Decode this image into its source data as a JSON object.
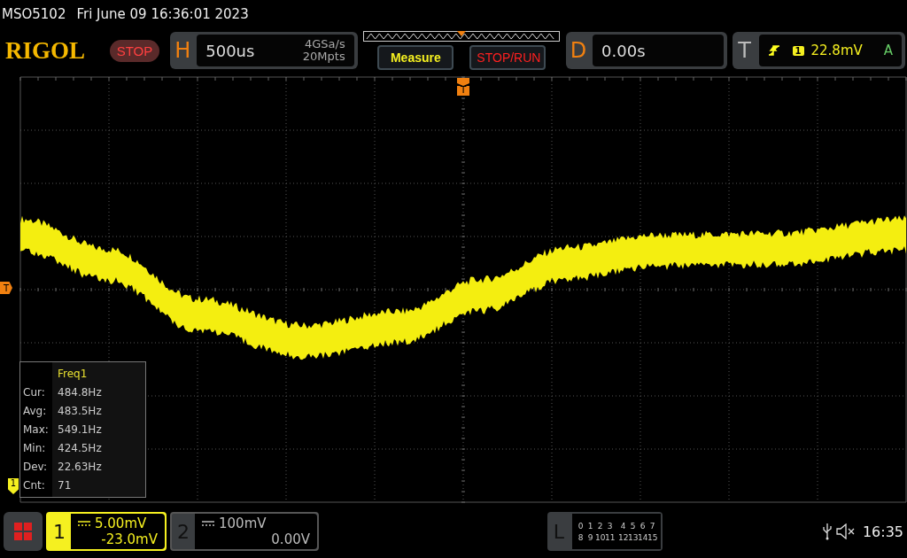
{
  "header": {
    "model": "MSO5102",
    "datetime": "Fri June 09 16:36:01 2023"
  },
  "toolbar": {
    "logo": "RIGOL",
    "run_state": "STOP",
    "horizontal": {
      "label": "H",
      "timebase": "500us",
      "sample_rate": "4GSa/s",
      "memory_depth": "20Mpts"
    },
    "buttons": [
      {
        "label": "Measure",
        "kind": "measure"
      },
      {
        "label": "STOP/RUN",
        "kind": "run"
      }
    ],
    "delay": {
      "label": "D",
      "value": "0.00s"
    },
    "trigger": {
      "label": "T",
      "source": "1",
      "level": "22.8mV",
      "mode": "A"
    }
  },
  "markers": {
    "trigger_position": "T",
    "trigger_level": "T",
    "channel_1": "1"
  },
  "measurement": {
    "title": "Freq1",
    "rows": [
      {
        "label": "Cur:",
        "value": "484.8Hz"
      },
      {
        "label": "Avg:",
        "value": "483.5Hz"
      },
      {
        "label": "Max:",
        "value": "549.1Hz"
      },
      {
        "label": "Min:",
        "value": "424.5Hz"
      },
      {
        "label": "Dev:",
        "value": "22.63Hz"
      },
      {
        "label": "Cnt:",
        "value": "71"
      }
    ]
  },
  "channels": [
    {
      "number": "1",
      "scale": "5.00mV",
      "offset": "-23.0mV",
      "selected": true
    },
    {
      "number": "2",
      "scale": "100mV",
      "offset": "0.00V",
      "selected": false
    }
  ],
  "logic": {
    "label": "L",
    "rows": [
      [
        "0",
        "1",
        "2",
        "3",
        "4",
        "5",
        "6",
        "7"
      ],
      [
        "8",
        "9",
        "10",
        "11",
        "12",
        "13",
        "14",
        "15"
      ]
    ]
  },
  "status": {
    "time": "16:35"
  }
}
